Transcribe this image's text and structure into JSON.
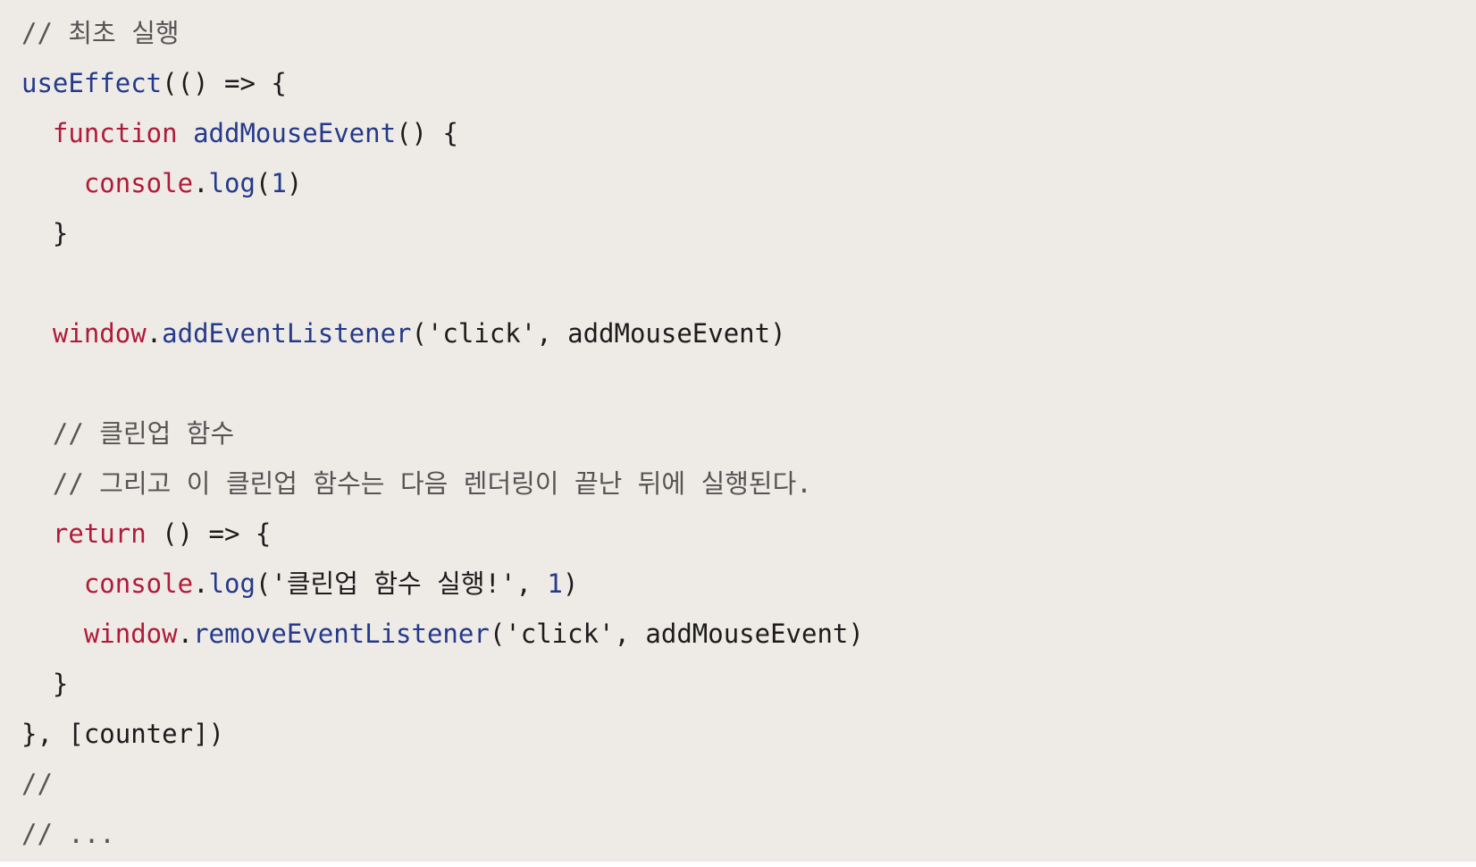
{
  "colors": {
    "background": "#eeeae6",
    "plain": "#1c1c1c",
    "comment": "#555555",
    "function": "#243a8a",
    "keyword": "#b01b3a",
    "number": "#243a8a"
  },
  "code": {
    "lines": [
      {
        "indent": 0,
        "tokens": [
          {
            "t": "comment",
            "v": "// 최초 실행"
          }
        ]
      },
      {
        "indent": 0,
        "tokens": [
          {
            "t": "fn",
            "v": "useEffect"
          },
          {
            "t": "plain",
            "v": "(() => {"
          }
        ]
      },
      {
        "indent": 1,
        "tokens": [
          {
            "t": "kw",
            "v": "function"
          },
          {
            "t": "plain",
            "v": " "
          },
          {
            "t": "fn",
            "v": "addMouseEvent"
          },
          {
            "t": "plain",
            "v": "() {"
          }
        ]
      },
      {
        "indent": 2,
        "tokens": [
          {
            "t": "kw",
            "v": "console"
          },
          {
            "t": "plain",
            "v": "."
          },
          {
            "t": "fn",
            "v": "log"
          },
          {
            "t": "plain",
            "v": "("
          },
          {
            "t": "num",
            "v": "1"
          },
          {
            "t": "plain",
            "v": ")"
          }
        ]
      },
      {
        "indent": 1,
        "tokens": [
          {
            "t": "plain",
            "v": "}"
          }
        ]
      },
      {
        "indent": 0,
        "tokens": []
      },
      {
        "indent": 1,
        "tokens": [
          {
            "t": "kw",
            "v": "window"
          },
          {
            "t": "plain",
            "v": "."
          },
          {
            "t": "fn",
            "v": "addEventListener"
          },
          {
            "t": "plain",
            "v": "('click', addMouseEvent)"
          }
        ]
      },
      {
        "indent": 0,
        "tokens": []
      },
      {
        "indent": 1,
        "tokens": [
          {
            "t": "comment",
            "v": "// 클린업 함수"
          }
        ]
      },
      {
        "indent": 1,
        "tokens": [
          {
            "t": "comment",
            "v": "// 그리고 이 클린업 함수는 다음 렌더링이 끝난 뒤에 실행된다."
          }
        ]
      },
      {
        "indent": 1,
        "tokens": [
          {
            "t": "kw",
            "v": "return"
          },
          {
            "t": "plain",
            "v": " () => {"
          }
        ]
      },
      {
        "indent": 2,
        "tokens": [
          {
            "t": "kw",
            "v": "console"
          },
          {
            "t": "plain",
            "v": "."
          },
          {
            "t": "fn",
            "v": "log"
          },
          {
            "t": "plain",
            "v": "('클린업 함수 실행!', "
          },
          {
            "t": "num",
            "v": "1"
          },
          {
            "t": "plain",
            "v": ")"
          }
        ]
      },
      {
        "indent": 2,
        "tokens": [
          {
            "t": "kw",
            "v": "window"
          },
          {
            "t": "plain",
            "v": "."
          },
          {
            "t": "fn",
            "v": "removeEventListener"
          },
          {
            "t": "plain",
            "v": "('click', addMouseEvent)"
          }
        ]
      },
      {
        "indent": 1,
        "tokens": [
          {
            "t": "plain",
            "v": "}"
          }
        ]
      },
      {
        "indent": 0,
        "tokens": [
          {
            "t": "plain",
            "v": "}, [counter])"
          }
        ]
      },
      {
        "indent": 0,
        "tokens": [
          {
            "t": "comment",
            "v": "//"
          }
        ]
      },
      {
        "indent": 0,
        "tokens": [
          {
            "t": "comment",
            "v": "// ..."
          }
        ]
      }
    ]
  }
}
